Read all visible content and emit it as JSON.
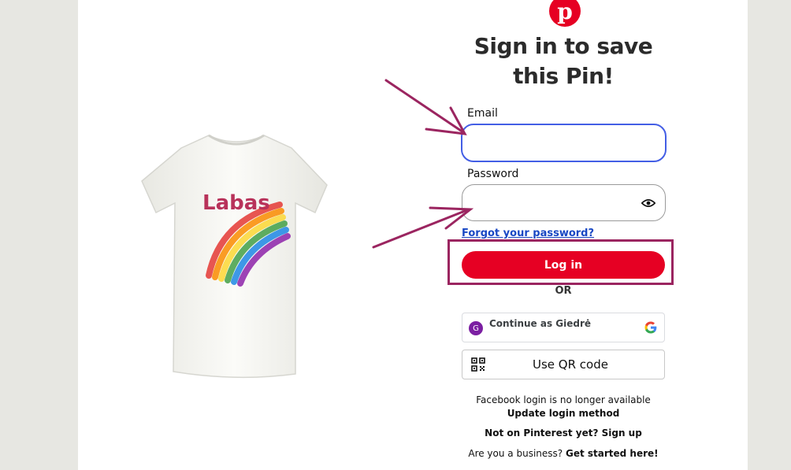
{
  "modal": {
    "logo_glyph": "p",
    "title": "Sign in to save this Pin!",
    "email_label": "Email",
    "email_value": "",
    "password_label": "Password",
    "password_value": "",
    "forgot_link": "Forgot your password?",
    "login_button": "Log in",
    "or_text": "OR",
    "google": {
      "avatar_initial": "G",
      "label": "Continue as Giedrė",
      "icon": "google-logo"
    },
    "qr_button": "Use QR code",
    "facebook_notice": "Facebook login is no longer available",
    "update_login": "Update login method",
    "not_on_pinterest": "Not on Pinterest yet? Sign up",
    "business_prefix": "Are you a business?",
    "business_link": "Get started here!"
  },
  "product": {
    "shirt_text": "Labas"
  },
  "colors": {
    "brand_red": "#e60023",
    "annotation": "#9b2560",
    "focus_blue": "#435ee5"
  }
}
